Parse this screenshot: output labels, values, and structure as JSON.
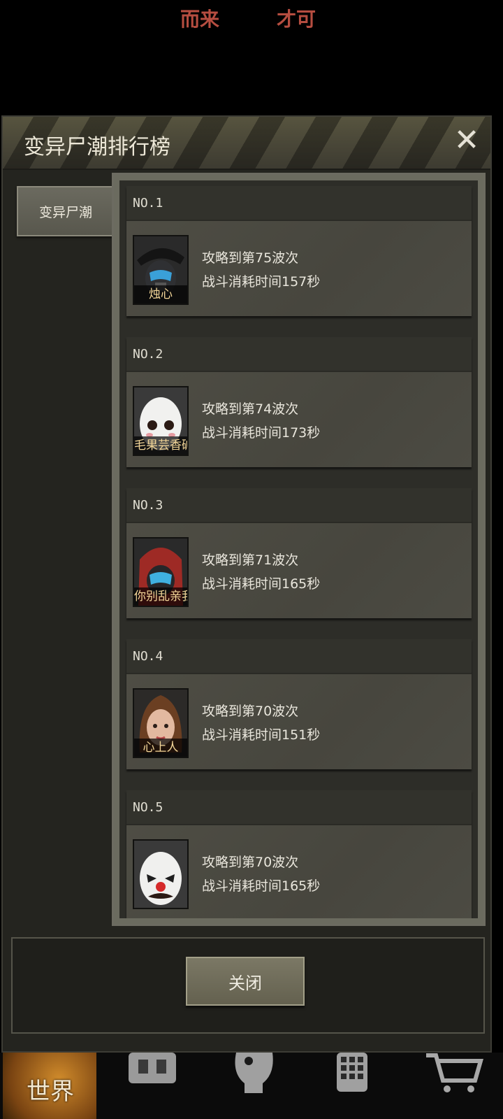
{
  "top_banner": {
    "text_left": "而来",
    "text_right": "才可"
  },
  "dialog": {
    "title": "变异尸潮排行榜",
    "close_glyph": "✕",
    "side_tab": "变异尸潮",
    "footer_button": "关闭"
  },
  "rankings": [
    {
      "rank": "NO.1",
      "name": "烛心",
      "line1": "攻略到第75波次",
      "line2": "战斗消耗时间157秒"
    },
    {
      "rank": "NO.2",
      "name": "毛果芸香碱",
      "line1": "攻略到第74波次",
      "line2": "战斗消耗时间173秒"
    },
    {
      "rank": "NO.3",
      "name": "你别乱亲我",
      "line1": "攻略到第71波次",
      "line2": "战斗消耗时间165秒"
    },
    {
      "rank": "NO.4",
      "name": "心上人",
      "line1": "攻略到第70波次",
      "line2": "战斗消耗时间151秒"
    },
    {
      "rank": "NO.5",
      "name": "",
      "line1": "攻略到第70波次",
      "line2": "战斗消耗时间165秒"
    }
  ],
  "bottom_nav": {
    "world_label": "世界"
  },
  "icons": [
    "close-icon",
    "backpack-icon",
    "head-icon",
    "phone-icon",
    "cart-icon"
  ]
}
